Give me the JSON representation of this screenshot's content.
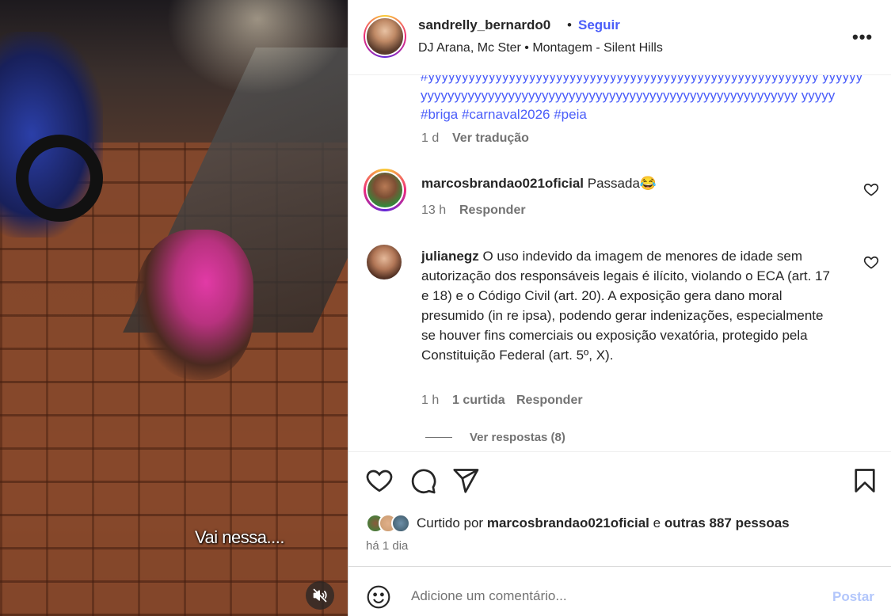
{
  "video": {
    "caption": "Vai nessa....",
    "mute_icon": "speaker-muted-icon"
  },
  "post": {
    "username": "sandrelly_bernardo0",
    "separator": "•",
    "follow_label": "Seguir",
    "audio": "DJ Arana, Mc Ster • Montagem - Silent Hills",
    "more_icon": "more-options-icon",
    "more_label": "•••"
  },
  "caption": {
    "hashtags_line": "#yyyyyyyyyyyyyyyyyyyyyyyyyyyyyyyyyyyyyyyyyyyyyyyyyyyyyyyyyy yyyyyyyyyyyyyyyyyyyyyyyyyyyyyyyyyyyyyyyyyyyyyyyyyyyyyyyyyyyyyy yyyyy",
    "tags": "#briga #carnaval2026 #peia",
    "age": "1 d",
    "translate": "Ver tradução"
  },
  "comments": [
    {
      "username": "marcosbrandao021oficial",
      "text": "Passada😂",
      "age": "13 h",
      "reply": "Responder"
    },
    {
      "username": "julianegz",
      "text": "O uso indevido da imagem de menores de idade sem autorização dos responsáveis legais é ilícito, violando o ECA (art. 17 e 18) e o Código Civil (art. 20). A exposição gera dano moral presumido (in re ipsa), podendo gerar indenizações, especialmente se houver fins comerciais ou exposição vexatória, protegido pela Constituição Federal (art. 5º, X).",
      "age": "1 h",
      "likes": "1 curtida",
      "reply": "Responder",
      "view_replies": "Ver respostas (8)"
    }
  ],
  "actions": {
    "like_icon": "heart-icon",
    "comment_icon": "comment-icon",
    "share_icon": "share-icon",
    "save_icon": "bookmark-icon"
  },
  "likes": {
    "prefix": "Curtido por",
    "user": "marcosbrandao021oficial",
    "conj": "e",
    "others": "outras 887 pessoas",
    "time": "há 1 dia"
  },
  "add_comment": {
    "placeholder": "Adicione um comentário...",
    "post_label": "Postar",
    "emoji_icon": "emoji-icon"
  },
  "colors": {
    "accent": "#4a5df9",
    "muted": "#737373",
    "post_disabled": "#b2c6fb"
  }
}
